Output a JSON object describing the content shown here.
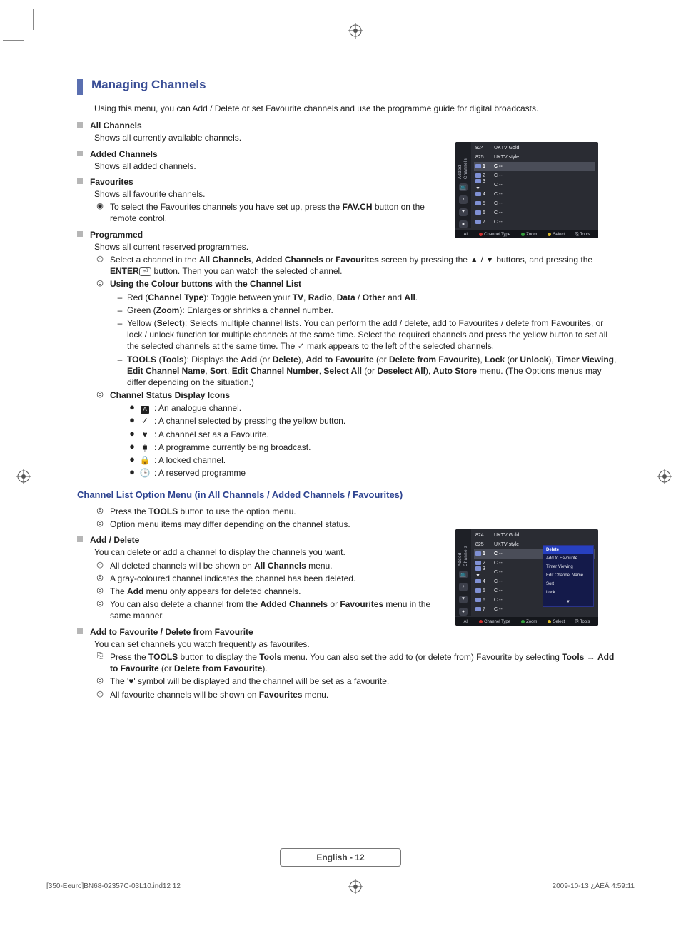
{
  "header": {
    "title": "Managing Channels",
    "intro": "Using this menu, you can Add / Delete or set Favourite channels and use the programme guide for digital broadcasts."
  },
  "sections": {
    "all": {
      "title": "All Channels",
      "desc": "Shows all currently available channels."
    },
    "added": {
      "title": "Added Channels",
      "desc": "Shows all added channels."
    },
    "fav": {
      "title": "Favourites",
      "desc": "Shows all favourite channels.",
      "note_prefix": "To select the Favourites channels you have set up, press the ",
      "note_bold": "FAV.CH",
      "note_suffix": " button on the remote control."
    },
    "prog": {
      "title": "Programmed",
      "desc": "Shows all current reserved programmes.",
      "n1_a": "Select a channel in the ",
      "n1_b": "All Channels",
      "n1_c": ", ",
      "n1_d": "Added Channels",
      "n1_e": " or ",
      "n1_f": "Favourites",
      "n1_g": " screen by pressing the ▲ / ▼ buttons, and pressing the ",
      "n1_h": "ENTER",
      "n1_i": " button. Then you can watch the selected channel.",
      "n2": "Using the Colour buttons with the Channel List",
      "d1_a": "Red (",
      "d1_b": "Channel Type",
      "d1_c": "): Toggle between your ",
      "d1_d": "TV",
      "d1_e": ", ",
      "d1_f": "Radio",
      "d1_g": ", ",
      "d1_h": "Data",
      "d1_i": " / ",
      "d1_j": "Other",
      "d1_k": " and ",
      "d1_l": "All",
      "d1_m": ".",
      "d2_a": "Green (",
      "d2_b": "Zoom",
      "d2_c": "): Enlarges or shrinks a channel number.",
      "d3_a": "Yellow (",
      "d3_b": "Select",
      "d3_c": "): Selects multiple channel lists. You can perform the add / delete, add to Favourites / delete from Favourites, or lock / unlock function for multiple channels at the same time. Select the required channels and press the yellow button to set all the selected channels at the same time. The ",
      "d3_d": "✓",
      "d3_e": " mark appears to the left of the selected channels.",
      "d4_a": "TOOLS",
      "d4_b": " (",
      "d4_c": "Tools",
      "d4_d": "): Displays the ",
      "d4_e": "Add",
      "d4_f": " (or ",
      "d4_g": "Delete",
      "d4_h": "), ",
      "d4_i": "Add to Favourite",
      "d4_j": " (or ",
      "d4_k": "Delete from Favourite",
      "d4_l": "), ",
      "d4_m": "Lock",
      "d4_n": " (or ",
      "d4_o": "Unlock",
      "d4_p": "), ",
      "d4_q": "Timer Viewing",
      "d4_r": ", ",
      "d4_s": "Edit Channel Name",
      "d4_t": ", ",
      "d4_u": "Sort",
      "d4_v": ", ",
      "d4_w": "Edit Channel Number",
      "d4_x": ", ",
      "d4_y": "Select All",
      "d4_z": " (or ",
      "d4_aa": "Deselect All",
      "d4_ab": "), ",
      "d4_ac": "Auto Store",
      "d4_ad": " menu. (The Options menus may differ depending on the situation.)",
      "n3": "Channel Status Display Icons",
      "ic1": ": An analogue channel.",
      "ic2": ": A channel selected by pressing the yellow button.",
      "ic3": ": A channel set as a Favourite.",
      "ic4": ": A programme currently being broadcast.",
      "ic5": ": A locked channel.",
      "ic6": ": A reserved programme"
    }
  },
  "option_menu": {
    "title": "Channel List Option Menu (in All Channels / Added Channels / Favourites)",
    "n1_a": "Press the ",
    "n1_b": "TOOLS",
    "n1_c": " button to use the option menu.",
    "n2": "Option menu items may differ depending on the channel status.",
    "ad": {
      "title": "Add / Delete",
      "desc": "You can delete or add a channel to display the channels you want.",
      "l1_a": "All deleted channels will be shown on ",
      "l1_b": "All Channels",
      "l1_c": " menu.",
      "l2": "A gray-coloured channel indicates the channel has been deleted.",
      "l3_a": "The ",
      "l3_b": "Add",
      "l3_c": " menu only appears for deleted channels.",
      "l4_a": "You can also delete a channel from the ",
      "l4_b": "Added Channels",
      "l4_c": " or ",
      "l4_d": "Favourites",
      "l4_e": " menu in the same manner."
    },
    "fav": {
      "title": "Add to Favourite / Delete from Favourite",
      "desc": "You can set channels you watch frequently as favourites.",
      "t1_a": "Press the ",
      "t1_b": "TOOLS",
      "t1_c": " button to display the ",
      "t1_d": "Tools",
      "t1_e": " menu. You can also set the add to (or delete from) Favourite by selecting ",
      "t1_f": "Tools",
      "t1_g": " → ",
      "t1_h": "Add to Favourite",
      "t1_i": " (or ",
      "t1_j": "Delete from Favourite",
      "t1_k": ").",
      "l2": "The '♥' symbol will be displayed and the channel will be set as a favourite.",
      "l3_a": "All favourite channels will be shown on ",
      "l3_b": "Favourites",
      "l3_c": " menu."
    }
  },
  "tv1": {
    "side_label": "Added Channels",
    "h1_num": "824",
    "h1_name": "UKTV Gold",
    "h2_num": "825",
    "h2_name": "UKTV style",
    "rows": [
      {
        "n": "1",
        "c": "C --"
      },
      {
        "n": "2",
        "c": "C --"
      },
      {
        "n": "3  ▼",
        "c": "C --"
      },
      {
        "n": "4",
        "c": "C --"
      },
      {
        "n": "5",
        "c": "C --"
      },
      {
        "n": "6",
        "c": "C --"
      },
      {
        "n": "7",
        "c": "C --"
      }
    ],
    "footer": {
      "all": "All",
      "ct": "Channel Type",
      "zm": "Zoom",
      "sel": "Select",
      "tl": "Tools"
    }
  },
  "tv2": {
    "side_label": "Added Channels",
    "h1_num": "824",
    "h1_name": "UKTV Gold",
    "h2_num": "825",
    "h2_name": "UKTV style",
    "rows": [
      {
        "n": "1",
        "c": "C --"
      },
      {
        "n": "2",
        "c": "C --"
      },
      {
        "n": "3  ▼",
        "c": "C --"
      },
      {
        "n": "4",
        "c": "C --"
      },
      {
        "n": "5",
        "c": "C --"
      },
      {
        "n": "6",
        "c": "C --"
      },
      {
        "n": "7",
        "c": "C --"
      }
    ],
    "menu": [
      "Delete",
      "Add to Favourite",
      "Timer Viewing",
      "Edit Channel Name",
      "Sort",
      "Lock",
      "▼"
    ],
    "footer": {
      "all": "All",
      "ct": "Channel Type",
      "zm": "Zoom",
      "sel": "Select",
      "tl": "Tools"
    }
  },
  "page_footer": {
    "page": "English - 12",
    "file": "[350-Eeuro]BN68-02357C-03L10.ind12   12",
    "date": "2009-10-13   ¿ÀÈÄ 4:59:11"
  }
}
